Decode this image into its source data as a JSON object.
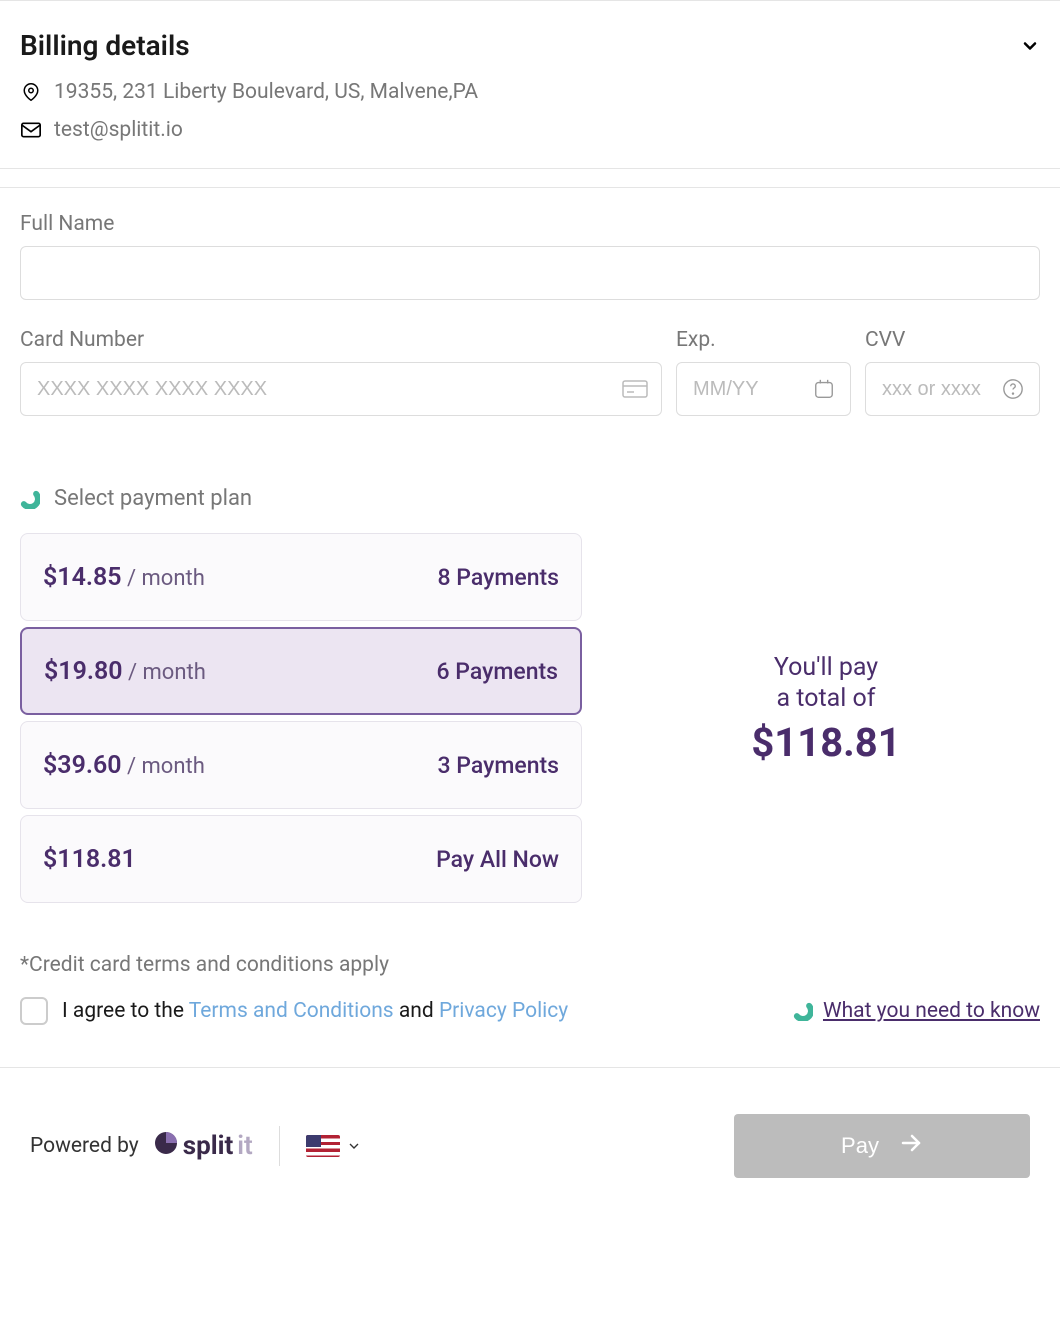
{
  "billing": {
    "title": "Billing details",
    "address": "19355, 231 Liberty Boulevard, US, Malvene,PA",
    "email": "test@splitit.io"
  },
  "form": {
    "full_name_label": "Full Name",
    "card_number_label": "Card Number",
    "card_number_placeholder": "XXXX XXXX XXXX XXXX",
    "exp_label": "Exp.",
    "exp_placeholder": "MM/YY",
    "cvv_label": "CVV",
    "cvv_placeholder": "xxx or xxxx"
  },
  "plan": {
    "header": "Select payment plan",
    "options": [
      {
        "price": "$14.85",
        "period": "/ month",
        "count": "8 Payments",
        "selected": false
      },
      {
        "price": "$19.80",
        "period": "/ month",
        "count": "6 Payments",
        "selected": true
      },
      {
        "price": "$39.60",
        "period": "/ month",
        "count": "3 Payments",
        "selected": false
      },
      {
        "price": "$118.81",
        "period": "",
        "count": "Pay All Now",
        "selected": false
      }
    ],
    "total_line1": "You'll pay",
    "total_line2": "a total of",
    "total_amount": "$118.81"
  },
  "terms": {
    "note": "*Credit card terms and conditions apply",
    "agree_prefix": "I agree to the ",
    "terms_link": "Terms and Conditions",
    "and": " and ",
    "privacy_link": "Privacy Policy",
    "know_link": "What you need to know"
  },
  "footer": {
    "powered_by": "Powered by",
    "brand_a": "split",
    "brand_b": "it",
    "pay_label": "Pay"
  }
}
